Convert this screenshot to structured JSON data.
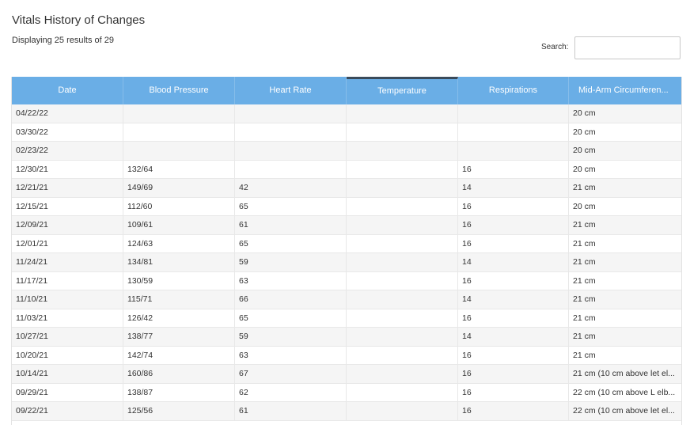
{
  "page": {
    "title": "Vitals History of Changes",
    "results_text": "Displaying 25 results of 29",
    "search_label": "Search:",
    "search_value": ""
  },
  "table": {
    "columns": [
      "Date",
      "Blood Pressure",
      "Heart Rate",
      "Temperature",
      "Respirations",
      "Mid-Arm Circumferen..."
    ],
    "sorted_column": "Temperature",
    "rows": [
      [
        "04/22/22",
        "",
        "",
        "",
        "",
        "20 cm"
      ],
      [
        "03/30/22",
        "",
        "",
        "",
        "",
        "20 cm"
      ],
      [
        "02/23/22",
        "",
        "",
        "",
        "",
        "20 cm"
      ],
      [
        "12/30/21",
        "132/64",
        "",
        "",
        "16",
        "20 cm"
      ],
      [
        "12/21/21",
        "149/69",
        "42",
        "",
        "14",
        "21 cm"
      ],
      [
        "12/15/21",
        "112/60",
        "65",
        "",
        "16",
        "20 cm"
      ],
      [
        "12/09/21",
        "109/61",
        "61",
        "",
        "16",
        "21 cm"
      ],
      [
        "12/01/21",
        "124/63",
        "65",
        "",
        "16",
        "21 cm"
      ],
      [
        "11/24/21",
        "134/81",
        "59",
        "",
        "14",
        "21 cm"
      ],
      [
        "11/17/21",
        "130/59",
        "63",
        "",
        "16",
        "21 cm"
      ],
      [
        "11/10/21",
        "115/71",
        "66",
        "",
        "14",
        "21 cm"
      ],
      [
        "11/03/21",
        "126/42",
        "65",
        "",
        "16",
        "21 cm"
      ],
      [
        "10/27/21",
        "138/77",
        "59",
        "",
        "14",
        "21 cm"
      ],
      [
        "10/20/21",
        "142/74",
        "63",
        "",
        "16",
        "21 cm"
      ],
      [
        "10/14/21",
        "160/86",
        "67",
        "",
        "16",
        "21 cm (10 cm above let el..."
      ],
      [
        "09/29/21",
        "138/87",
        "62",
        "",
        "16",
        "22 cm (10 cm above L elb..."
      ],
      [
        "09/22/21",
        "125/56",
        "61",
        "",
        "16",
        "22 cm (10 cm above let el..."
      ]
    ]
  },
  "colors": {
    "header_bg": "#6aaee6",
    "header_text": "#ffffff",
    "row_alt": "#f5f5f5",
    "sort_indicator": "#3a4a5a"
  }
}
